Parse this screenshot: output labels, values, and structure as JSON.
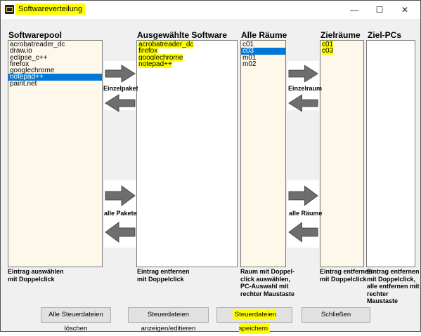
{
  "window": {
    "title": "Softwareverteilung",
    "minimize": "—",
    "maximize": "☐",
    "close": "✕"
  },
  "columns": {
    "pool": {
      "title": "Softwarepool",
      "items": [
        {
          "label": "acrobatreader_dc",
          "selected": false,
          "highlighted": false
        },
        {
          "label": "draw.io",
          "selected": false,
          "highlighted": false
        },
        {
          "label": "eclipse_c++",
          "selected": false,
          "highlighted": false
        },
        {
          "label": "firefox",
          "selected": false,
          "highlighted": false
        },
        {
          "label": "googlechrome",
          "selected": false,
          "highlighted": false
        },
        {
          "label": "notepad++",
          "selected": true,
          "highlighted": false
        },
        {
          "label": "paint.net",
          "selected": false,
          "highlighted": false
        }
      ],
      "hint": "Eintrag auswählen\nmit Doppelclick"
    },
    "selected_software": {
      "title": "Ausgewählte Software",
      "items": [
        {
          "label": "acrobatreader_dc",
          "selected": false,
          "highlighted": true
        },
        {
          "label": "firefox",
          "selected": false,
          "highlighted": true
        },
        {
          "label": "googlechrome",
          "selected": false,
          "highlighted": true
        },
        {
          "label": "notepad++",
          "selected": false,
          "highlighted": true
        }
      ],
      "hint": "Eintrag entfernen\nmit Doppelclick"
    },
    "rooms": {
      "title": "Alle Räume",
      "items": [
        {
          "label": "c01",
          "selected": false,
          "highlighted": false
        },
        {
          "label": "c03",
          "selected": true,
          "highlighted": false
        },
        {
          "label": "m01",
          "selected": false,
          "highlighted": false
        },
        {
          "label": "m02",
          "selected": false,
          "highlighted": false
        }
      ],
      "hint": "Raum mit Doppel-\nclick auswählen,\nPC-Auswahl mit\nrechter Maustaste"
    },
    "target_rooms": {
      "title": "Zielräume",
      "items": [
        {
          "label": "c01",
          "selected": false,
          "highlighted": true
        },
        {
          "label": "c03",
          "selected": false,
          "highlighted": true
        }
      ],
      "hint": "Eintrag entfernen\nmit Doppelclick"
    },
    "target_pcs": {
      "title": "Ziel-PCs",
      "items": [],
      "hint": "Eintrag entfernen\nmit Doppelclick,\nalle entfernen mit\nrechter Maustaste"
    }
  },
  "arrows": {
    "software_single_label": "Einzelpaket",
    "software_all_label": "alle Pakete",
    "rooms_single_label": "Einzelraum",
    "rooms_all_label": "alle Räume"
  },
  "buttons": {
    "delete_all": "Alle Steuerdateien löschen",
    "show_edit": "Steuerdateien anzeigen/editieren",
    "save": "Steuerdateien speichern",
    "close": "Schließen"
  },
  "colors": {
    "selection": "#0078d7",
    "highlight": "#ffff00",
    "list_background": "#fdf8ea"
  }
}
